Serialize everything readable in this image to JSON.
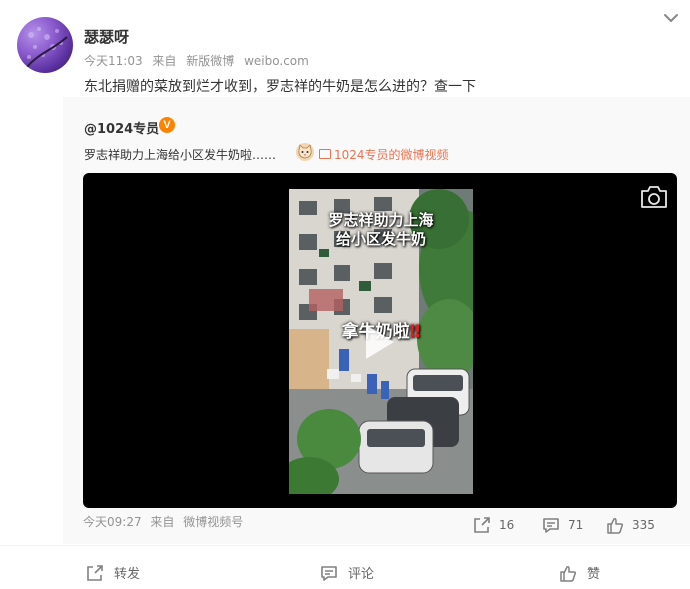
{
  "author": {
    "name": "瑟瑟呀",
    "time": "今天11:03",
    "from_prefix": "来自",
    "client": "新版微博",
    "site": "weibo.com"
  },
  "post": {
    "text": "东北捐赠的菜放到烂才收到，罗志祥的牛奶是怎么进的？查一下"
  },
  "repost": {
    "user": "@1024专员",
    "badge": "V",
    "text": "罗志祥助力上海给小区发牛奶啦……",
    "link_label": "1024专员的微博视频",
    "video": {
      "caption_line1": "罗志祥助力上海",
      "caption_line2": "给小区发牛奶",
      "overlay_text": "拿牛奶啦",
      "overlay_mark": "‼"
    },
    "time": "今天09:27",
    "from_prefix": "来自",
    "source": "微博视频号",
    "stats": {
      "reposts": "16",
      "comments": "71",
      "likes": "335"
    }
  },
  "actions": {
    "repost": "转发",
    "comment": "评论",
    "like": "赞"
  },
  "icons": {
    "menu": "chevron-down-icon",
    "camera": "camera-icon",
    "play": "play-icon",
    "repost": "share-icon",
    "comment": "comment-icon",
    "like": "thumbs-up-icon"
  },
  "colors": {
    "link": "#eb7350",
    "badge": "#ff8200",
    "muted": "#939393",
    "repost_bg": "#f9f9f9"
  }
}
